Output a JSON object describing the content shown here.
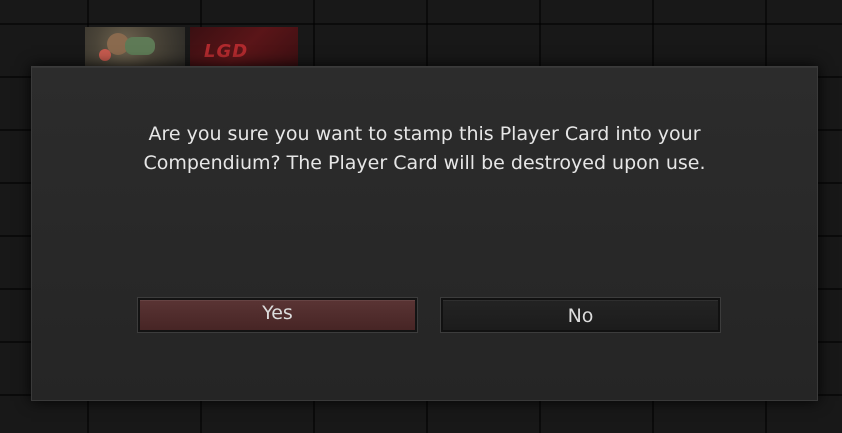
{
  "background": {
    "thumbnails": [
      {
        "name": "hero-thumbnail"
      },
      {
        "name": "team-thumbnail",
        "logo_text": "LGD"
      }
    ]
  },
  "dialog": {
    "message_line1": "Are you sure you want to stamp this Player Card into your",
    "message_line2": "Compendium? The Player Card will be destroyed upon use.",
    "yes_label": "Yes",
    "no_label": "No"
  },
  "colors": {
    "dialog_bg": "#2a2a2a",
    "yes_button": "#502d2d",
    "no_button": "#202020",
    "text": "#e6e6e6"
  }
}
